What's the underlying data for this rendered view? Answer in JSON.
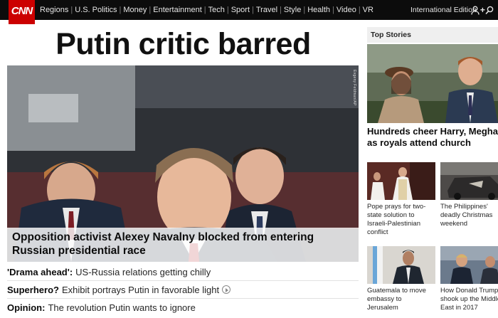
{
  "brand": {
    "logo_text": "CNN",
    "accent": "#cc0000"
  },
  "nav": {
    "items": [
      "Regions",
      "U.S. Politics",
      "Money",
      "Entertainment",
      "Tech",
      "Sport",
      "Travel",
      "Style",
      "Health",
      "Video",
      "VR"
    ],
    "edition": "International Edition",
    "edition_icon": "plus-icon",
    "icons": [
      "user-icon",
      "search-icon"
    ]
  },
  "main": {
    "headline": "Putin critic barred",
    "hero_credit": "Evgeny Feldman/AP",
    "hero_caption": "Opposition activist Alexey Navalny blocked from entering Russian presidential race",
    "stories": [
      {
        "lead": "'Drama ahead':",
        "text": "US-Russia relations getting chilly",
        "video": false
      },
      {
        "lead": "Superhero?",
        "text": "Exhibit portrays Putin in favorable light",
        "video": true
      },
      {
        "lead": "Opinion:",
        "text": "The revolution Putin wants to ignore",
        "video": false
      }
    ]
  },
  "top_stories": {
    "heading": "Top Stories",
    "main_title_line1": "Hundreds cheer Harry, Meghan",
    "main_title_line2": "as royals attend church",
    "cards": [
      {
        "lines": [
          "Pope prays for two-",
          "state solution to",
          "Israeli-Palestinian",
          "conflict"
        ]
      },
      {
        "lines": [
          "The Philippines'",
          "deadly Christmas",
          "weekend"
        ]
      },
      {
        "lines": [
          "Guatemala to move",
          "embassy to",
          "Jerusalem"
        ]
      },
      {
        "lines": [
          "How Donald Trump",
          "shook up the Middle",
          "East in 2017"
        ]
      }
    ]
  }
}
